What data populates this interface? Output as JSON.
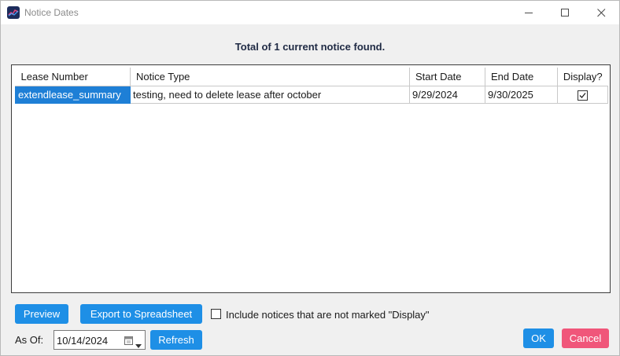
{
  "window": {
    "title": "Notice Dates"
  },
  "summary": "Total of 1 current notice found.",
  "table": {
    "columns": [
      "Lease Number",
      "Notice Type",
      "Start Date",
      "End Date",
      "Display?"
    ],
    "rows": [
      {
        "lease_number": "extendlease_summary",
        "notice_type": "testing, need to delete lease after october",
        "start_date": "9/29/2024",
        "end_date": "9/30/2025",
        "display": true
      }
    ]
  },
  "buttons": {
    "preview": "Preview",
    "export": "Export to Spreadsheet",
    "refresh": "Refresh",
    "ok": "OK",
    "cancel": "Cancel"
  },
  "include_checkbox": {
    "label": "Include notices that are not marked \"Display\"",
    "checked": false
  },
  "as_of": {
    "label": "As Of:",
    "value": "10/14/2024"
  },
  "colors": {
    "primary_button": "#1e8fe6",
    "cancel_button": "#f0567a",
    "selection": "#1e7fd6"
  },
  "icons": {
    "app": "app-logo-icon",
    "minimize": "minimize-icon",
    "maximize": "maximize-icon",
    "close": "close-icon",
    "calendar": "calendar-icon",
    "dropdown": "chevron-down-icon"
  }
}
